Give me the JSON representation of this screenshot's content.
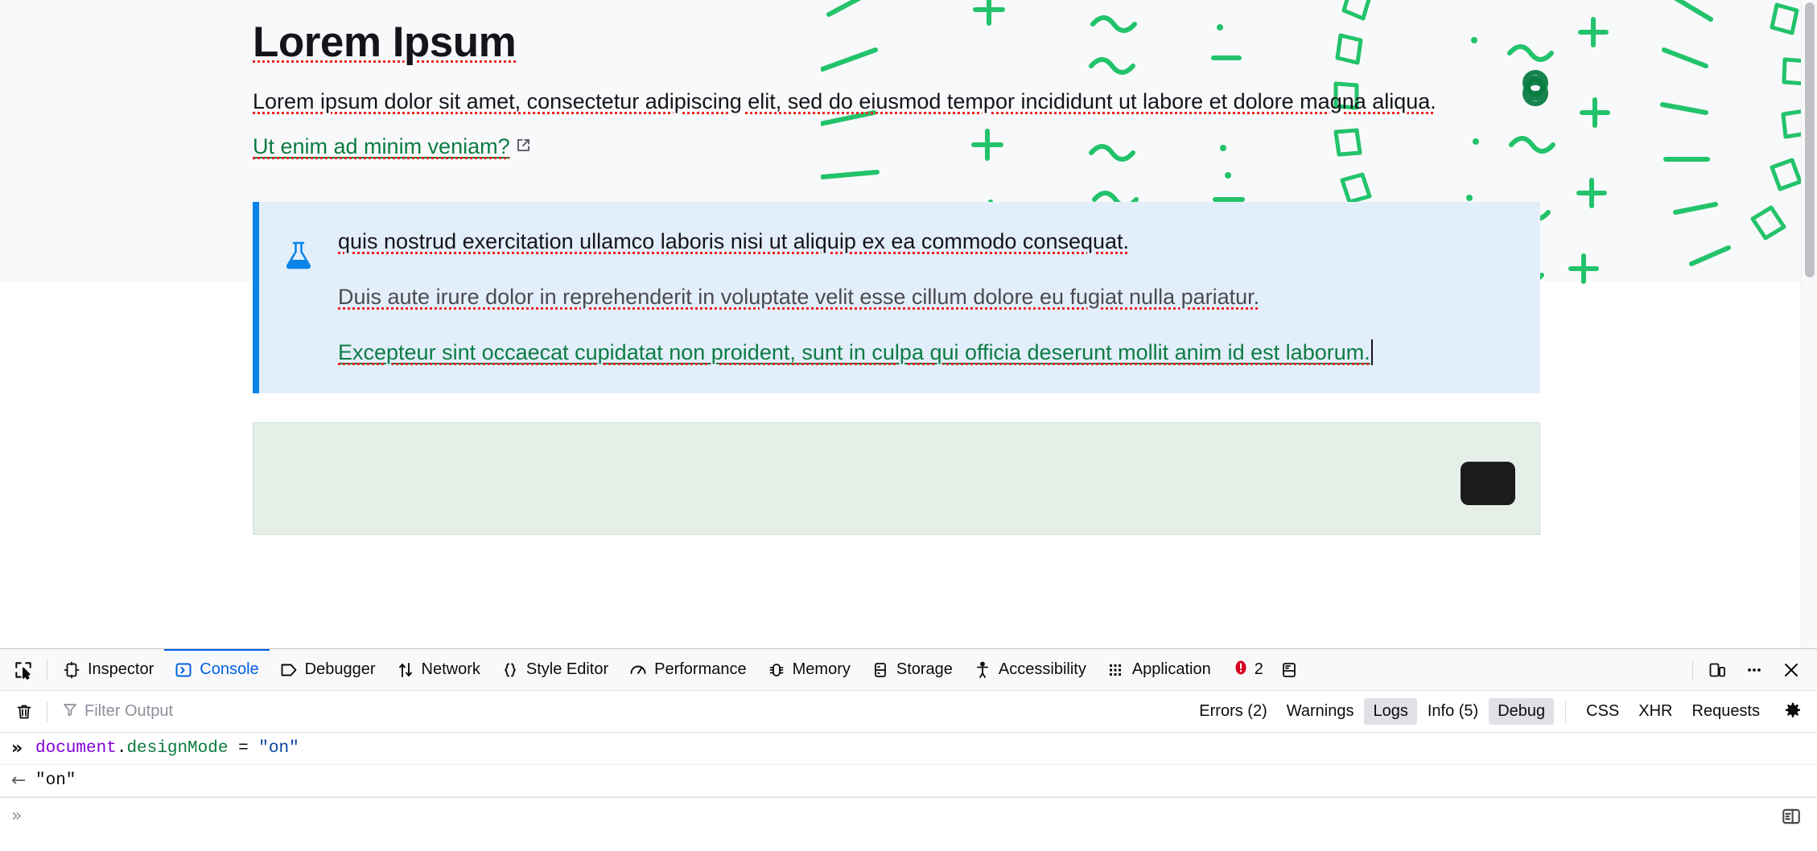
{
  "page": {
    "title": "Lorem Ipsum",
    "lead": "Lorem ipsum dolor sit amet, consectetur adipiscing elit, sed do eiusmod tempor incididunt ut labore et dolore magna aliqua.",
    "link_text": "Ut enim ad minim veniam?",
    "link_icon": "external-link-icon",
    "callout": {
      "icon": "flask-icon",
      "icon_color": "#0a84e8",
      "accent_color": "#0a84e8",
      "background": "#e3eefb",
      "paragraph_1": "quis nostrud exercitation ullamco laboris nisi ut aliquip ex ea commodo consequat.",
      "paragraph_2": "Duis aute irure dolor in reprehenderit in voluptate velit esse cillum dolore eu fugiat nulla pariatur.",
      "link_paragraph": "Excepteur sint occaecat cupidatat non proident, sunt in culpa qui officia deserunt mollit anim id est laborum."
    },
    "greenbox": {
      "background": "#e5efe8",
      "button_label": "",
      "caption": ""
    },
    "spellcheck_underline_color": "#e22",
    "link_color": "#0b7c42"
  },
  "devtools": {
    "picker_icon": "element-picker-icon",
    "tabs": [
      {
        "label": "Inspector",
        "icon": "inspector-icon",
        "active": false
      },
      {
        "label": "Console",
        "icon": "console-icon",
        "active": true
      },
      {
        "label": "Debugger",
        "icon": "debugger-icon",
        "active": false
      },
      {
        "label": "Network",
        "icon": "network-icon",
        "active": false
      },
      {
        "label": "Style Editor",
        "icon": "style-editor-icon",
        "active": false
      },
      {
        "label": "Performance",
        "icon": "performance-icon",
        "active": false
      },
      {
        "label": "Memory",
        "icon": "memory-icon",
        "active": false
      },
      {
        "label": "Storage",
        "icon": "storage-icon",
        "active": false
      },
      {
        "label": "Accessibility",
        "icon": "accessibility-icon",
        "active": false
      },
      {
        "label": "Application",
        "icon": "application-icon",
        "active": false
      }
    ],
    "error_count": "2",
    "error_icon": "error-badge-icon",
    "jsterm_icon": "split-console-icon",
    "responsive_icon": "responsive-design-mode-icon",
    "meatball_icon": "more-options-icon",
    "close_icon": "close-icon",
    "filterbar": {
      "clear_icon": "trash-icon",
      "filter_icon": "filter-icon",
      "filter_value": "",
      "filter_placeholder": "Filter Output",
      "buttons": [
        {
          "label": "Errors (2)",
          "active": false
        },
        {
          "label": "Warnings",
          "active": false
        },
        {
          "label": "Logs",
          "active": true
        },
        {
          "label": "Info (5)",
          "active": false
        },
        {
          "label": "Debug",
          "active": true
        },
        {
          "label": "CSS",
          "active": false
        },
        {
          "label": "XHR",
          "active": false
        },
        {
          "label": "Requests",
          "active": false
        }
      ],
      "settings_icon": "gear-icon"
    },
    "console": {
      "input_arrow": "»",
      "return_arrow": "←",
      "entry_object": "document",
      "entry_dot": ".",
      "entry_property": "designMode",
      "entry_operator": " = ",
      "entry_value": "\"on\"",
      "result_value": "\"on\"",
      "prompt_arrow": "»",
      "prompt_value": "",
      "split_console_icon": "split-console-icon"
    }
  }
}
